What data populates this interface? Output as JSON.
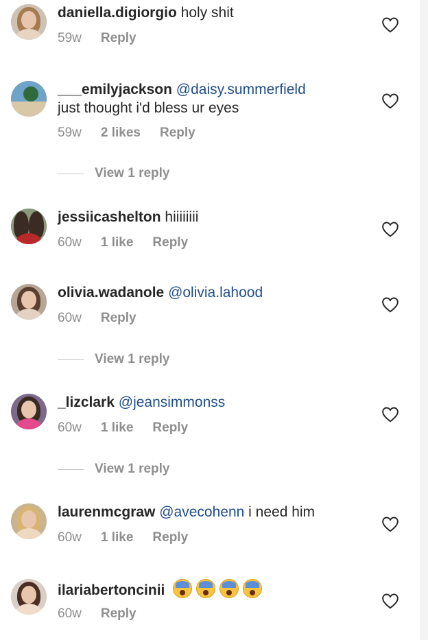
{
  "comments": [
    {
      "username": "daniella.digiorgio",
      "mention": "",
      "text": "holy shit",
      "time": "59w",
      "likes": "",
      "reply_label": "Reply",
      "view_replies": "",
      "avatar_colors": [
        "#cfc2b5",
        "#a57c52",
        "#e7d4c2"
      ]
    },
    {
      "username": "___emilyjackson",
      "mention": "@daisy.summerfield",
      "text": "just thought i'd bless ur eyes",
      "time": "59w",
      "likes": "2 likes",
      "reply_label": "Reply",
      "view_replies": "View 1 reply",
      "avatar_colors": [
        "#6fa3c9",
        "#2f6b3a",
        "#d9c8a8"
      ]
    },
    {
      "username": "jessiicashelton",
      "mention": "",
      "text": "hiiiiiiii",
      "time": "60w",
      "likes": "1 like",
      "reply_label": "Reply",
      "view_replies": "",
      "avatar_colors": [
        "#8a9a7b",
        "#3a2c25",
        "#b8292b"
      ]
    },
    {
      "username": "olivia.wadanole",
      "mention": "@olivia.lahood",
      "text": "",
      "time": "60w",
      "likes": "",
      "reply_label": "Reply",
      "view_replies": "View 1 reply",
      "avatar_colors": [
        "#b7a595",
        "#5b4030",
        "#e3d2c4"
      ]
    },
    {
      "username": "_lizclark",
      "mention": "@jeansimmonss",
      "text": "",
      "time": "60w",
      "likes": "1 like",
      "reply_label": "Reply",
      "view_replies": "View 1 reply",
      "avatar_colors": [
        "#7d6a8a",
        "#3a2a22",
        "#e24a8c"
      ]
    },
    {
      "username": "laurenmcgraw",
      "mention": "@avecohenn",
      "text": "i need him",
      "time": "60w",
      "likes": "1 like",
      "reply_label": "Reply",
      "view_replies": "",
      "avatar_colors": [
        "#c9b48f",
        "#d9b470",
        "#efd8c0"
      ]
    },
    {
      "username": "ilariabertoncinii",
      "mention": "",
      "text": "",
      "emoji": "😱😱😱😱",
      "time": "60w",
      "likes": "",
      "reply_label": "Reply",
      "view_replies": "",
      "avatar_colors": [
        "#d8cfc7",
        "#4a2e22",
        "#f0dcc9"
      ]
    }
  ],
  "icons": {
    "like": "heart-outline-icon",
    "reaction": "screaming-face-emoji"
  },
  "colors": {
    "mention": "#1f4d8b",
    "meta": "#8e8e8e",
    "text": "#262626"
  }
}
